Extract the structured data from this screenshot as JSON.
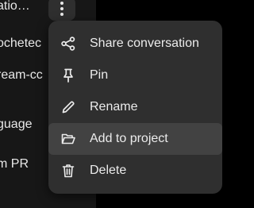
{
  "sidebar": {
    "items": [
      {
        "label": "atio…"
      },
      {
        "label": "ochetec"
      },
      {
        "label": "ream-cc"
      },
      {
        "label": "guage"
      },
      {
        "label": "m PR"
      }
    ]
  },
  "more_button": {
    "icon": "more-vertical-icon"
  },
  "context_menu": {
    "items": [
      {
        "label": "Share conversation",
        "icon": "share-icon"
      },
      {
        "label": "Pin",
        "icon": "pin-icon"
      },
      {
        "label": "Rename",
        "icon": "pencil-icon"
      },
      {
        "label": "Add to project",
        "icon": "folder-open-icon"
      },
      {
        "label": "Delete",
        "icon": "trash-icon"
      }
    ]
  },
  "colors": {
    "background": "#000000",
    "sidebar": "#171717",
    "menu": "#2f2f2f",
    "menu_hover": "#424242",
    "text": "#ececec"
  }
}
